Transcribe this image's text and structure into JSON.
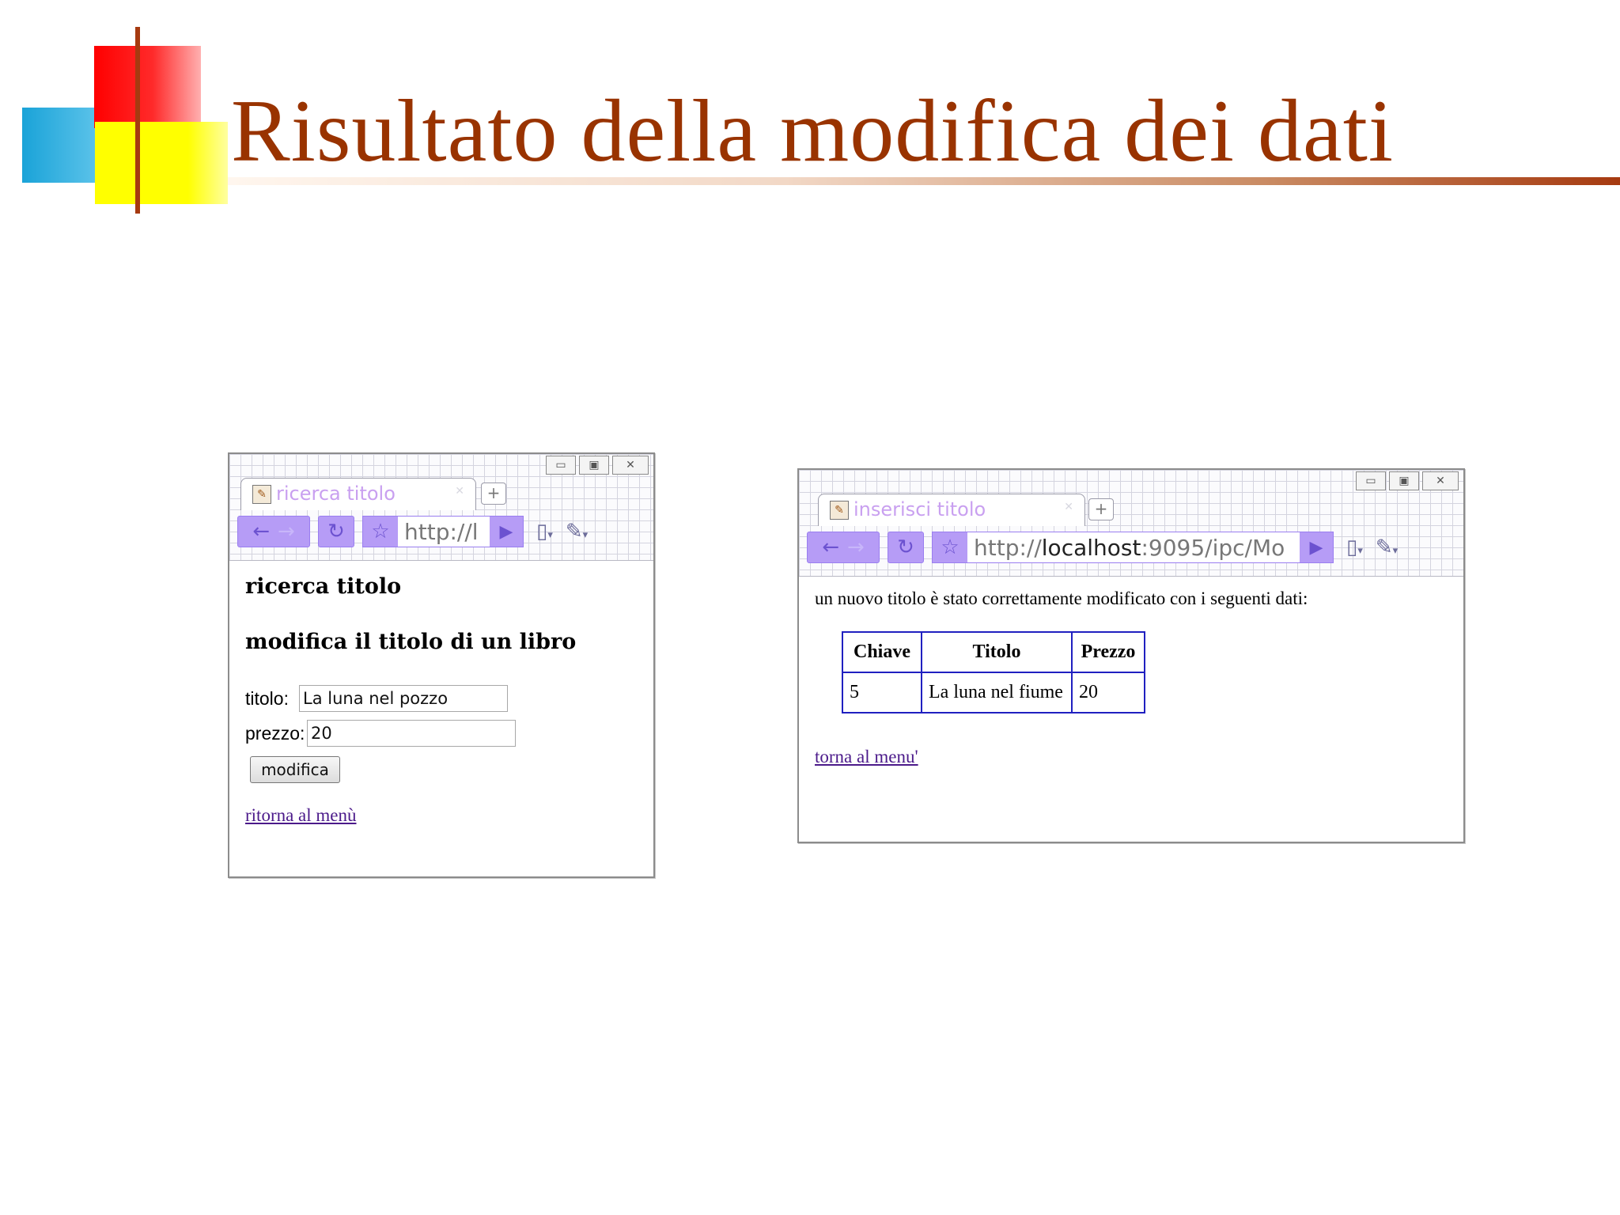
{
  "slide": {
    "title": "Risultato della modifica dei dati"
  },
  "left_browser": {
    "tab_title": "ricerca titolo",
    "address": "http://l",
    "heading": "ricerca titolo",
    "subheading": "modifica il titolo di un libro",
    "form": {
      "titolo_label": "titolo:",
      "titolo_value": "La luna nel pozzo",
      "prezzo_label": "prezzo:",
      "prezzo_value": "20",
      "submit_label": "modifica"
    },
    "link": "ritorna al menù"
  },
  "right_browser": {
    "tab_title": "inserisci titolo",
    "address_scheme": "http://",
    "address_host": "localhost",
    "address_rest": ":9095/ipc/Mo",
    "message": "un nuovo titolo è stato correttamente modificato con i seguenti dati:",
    "table": {
      "headers": [
        "Chiave",
        "Titolo",
        "Prezzo"
      ],
      "rows": [
        [
          "5",
          "La luna nel fiume",
          "20"
        ]
      ]
    },
    "link": "torna al menu'"
  },
  "icons": {
    "back": "arrow-left",
    "forward": "arrow-right",
    "reload": "reload",
    "bookmark": "star",
    "go": "play",
    "page_menu": "page",
    "tools_menu": "wrench"
  },
  "colors": {
    "title": "#993300",
    "toolbar_accent": "#b69cf6",
    "table_border": "#2020c0",
    "link": "#4b1a8a"
  }
}
